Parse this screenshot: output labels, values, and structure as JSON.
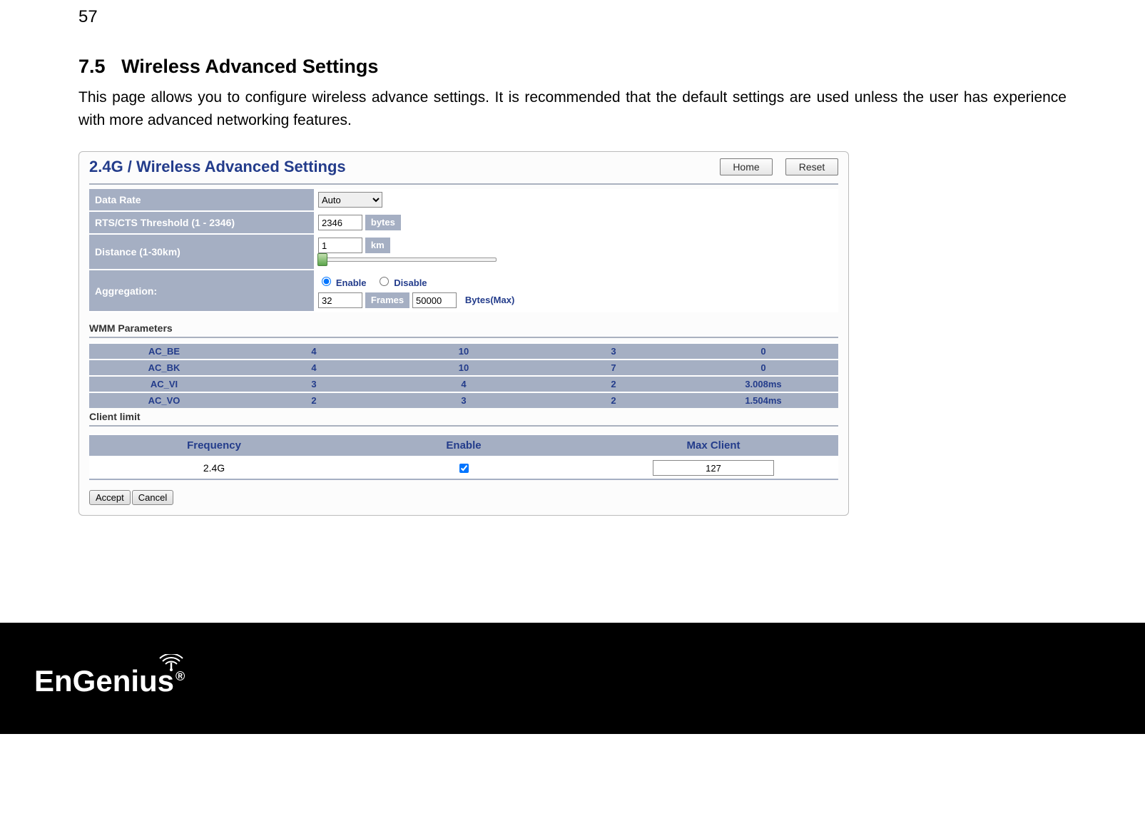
{
  "page_number": "57",
  "section_number": "7.5",
  "section_title": "Wireless Advanced Settings",
  "section_intro": "This page allows you to configure wireless advance settings. It is recommended that the default settings are used unless the user has experience with more advanced networking features.",
  "config": {
    "title": "2.4G / Wireless Advanced Settings",
    "home_btn": "Home",
    "reset_btn": "Reset",
    "rows": {
      "data_rate": {
        "label": "Data Rate",
        "value": "Auto"
      },
      "rts": {
        "label": "RTS/CTS Threshold (1 - 2346)",
        "value": "2346",
        "unit": "bytes"
      },
      "distance": {
        "label": "Distance (1-30km)",
        "value": "1",
        "unit": "km"
      },
      "aggregation": {
        "label": "Aggregation:",
        "enable_label": "Enable",
        "disable_label": "Disable",
        "frames_value": "32",
        "frames_label": "Frames",
        "bytes_value": "50000",
        "bytes_label": "Bytes(Max)"
      }
    },
    "wmm": {
      "heading": "WMM Parameters",
      "rows": [
        {
          "name": "AC_BE",
          "c1": "4",
          "c2": "10",
          "c3": "3",
          "c4": "0"
        },
        {
          "name": "AC_BK",
          "c1": "4",
          "c2": "10",
          "c3": "7",
          "c4": "0"
        },
        {
          "name": "AC_VI",
          "c1": "3",
          "c2": "4",
          "c3": "2",
          "c4": "3.008ms"
        },
        {
          "name": "AC_VO",
          "c1": "2",
          "c2": "3",
          "c3": "2",
          "c4": "1.504ms"
        }
      ]
    },
    "client": {
      "heading": "Client limit",
      "headers": {
        "freq": "Frequency",
        "enable": "Enable",
        "max": "Max Client"
      },
      "row": {
        "freq": "2.4G",
        "max": "127"
      }
    },
    "accept_btn": "Accept",
    "cancel_btn": "Cancel"
  },
  "footer_brand": "EnGenius"
}
